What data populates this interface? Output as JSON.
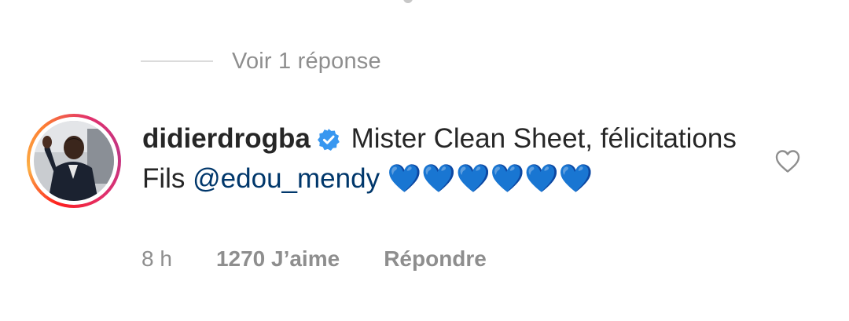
{
  "view_replies": {
    "label": "Voir 1 réponse"
  },
  "comment": {
    "username": "didierdrogba",
    "text_before_mention": " Mister Clean Sheet, félicitations Fils ",
    "mention": "@edou_mendy",
    "text_after_mention": " ",
    "hearts": "💙💙💙💙💙💙"
  },
  "meta": {
    "time": "8 h",
    "likes": "1270 J’aime",
    "reply": "Répondre"
  },
  "colors": {
    "verified_badge": "#3897f0",
    "mention": "#00376b",
    "muted_text": "#8e8e8e",
    "heart_emoji": "#2b8fe6"
  },
  "icons": {
    "verified": "verified-badge-icon",
    "like": "heart-outline-icon"
  }
}
